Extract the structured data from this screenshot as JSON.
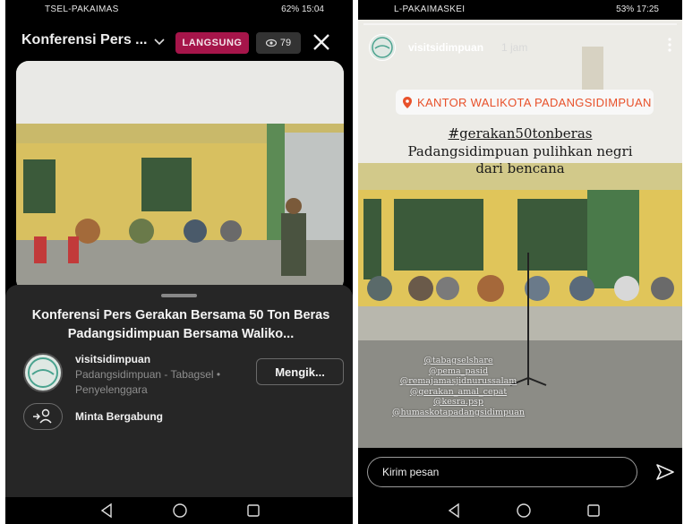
{
  "phone1": {
    "status_left": "TSEL-PAKAIMAS",
    "status_right": "62%  15:04",
    "header": {
      "title": "Konferensi Pers ...",
      "live_badge": "LANGSUNG",
      "viewer_count": "79"
    },
    "sheet": {
      "broadcast_title": "Konferensi Pers Gerakan Bersama 50 Ton Beras Padangsidimpuan Bersama Waliko...",
      "account_name": "visitsidimpuan",
      "account_sub": "Padangsidimpuan - Tabagsel • Penyelenggara",
      "follow_label": "Mengik...",
      "join_label": "Minta Bergabung"
    }
  },
  "phone2": {
    "status_left": "L-PAKAIMASKEI",
    "status_right": "53%  17:25",
    "story": {
      "username": "visitsidimpuan",
      "time": "1 jam",
      "location": "KANTOR WALIKOTA PADANGSIDIMPUAN",
      "hashtag": "#gerakan50tonberas",
      "caption_line1": "Padangsidimpuan pulihkan negri",
      "caption_line2": "dari bencana",
      "mentions": [
        "@tabagselshare",
        "@pema_pasid",
        "@remajamasjidnurussalam",
        "@gerakan_amal_cepat",
        "@kesra.psp",
        "@humaskotapadangsidimpuan"
      ],
      "reply_placeholder": "Kirim pesan"
    }
  },
  "colors": {
    "live_badge": "#a6154a",
    "location_text": "#e8512a",
    "sheet_bg": "#262626"
  },
  "icons": [
    "chevron-down-icon",
    "eye-icon",
    "close-icon",
    "person-add-icon",
    "back-icon",
    "home-icon",
    "recents-icon",
    "location-pin-icon",
    "more-icon",
    "send-icon"
  ]
}
